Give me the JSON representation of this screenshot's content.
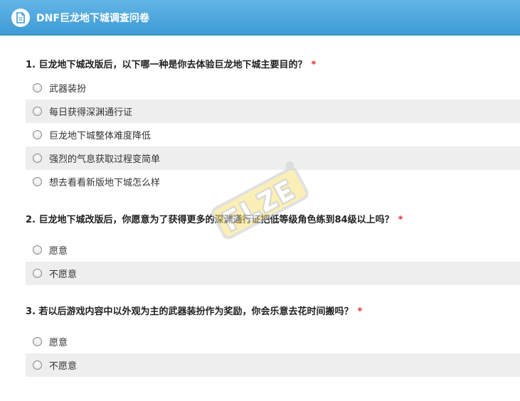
{
  "header": {
    "title": "DNF巨龙地下城调查问卷",
    "icon": "document-icon"
  },
  "questions": [
    {
      "number": "1.",
      "text": "巨龙地下城改版后，以下哪一种是你去体验巨龙地下城主要目的？",
      "required_mark": "*",
      "options": [
        "武器装扮",
        "每日获得深渊通行证",
        "巨龙地下城整体难度降低",
        "强烈的气息获取过程变简单",
        "想去看看新版地下城怎么样"
      ]
    },
    {
      "number": "2.",
      "text": "巨龙地下城改版后，你愿意为了获得更多的深渊通行证把低等级角色练到84级以上吗？",
      "required_mark": "*",
      "options": [
        "愿意",
        "不愿意"
      ]
    },
    {
      "number": "3.",
      "text": "若以后游戏内容中以外观为主的武器装扮作为奖励，你会乐意去花时间搬吗？",
      "required_mark": "*",
      "options": [
        "愿意",
        "不愿意"
      ]
    }
  ],
  "colors": {
    "header_bg": "#4aa7de",
    "required": "#e0302a",
    "alt_row": "#eeeeee"
  }
}
